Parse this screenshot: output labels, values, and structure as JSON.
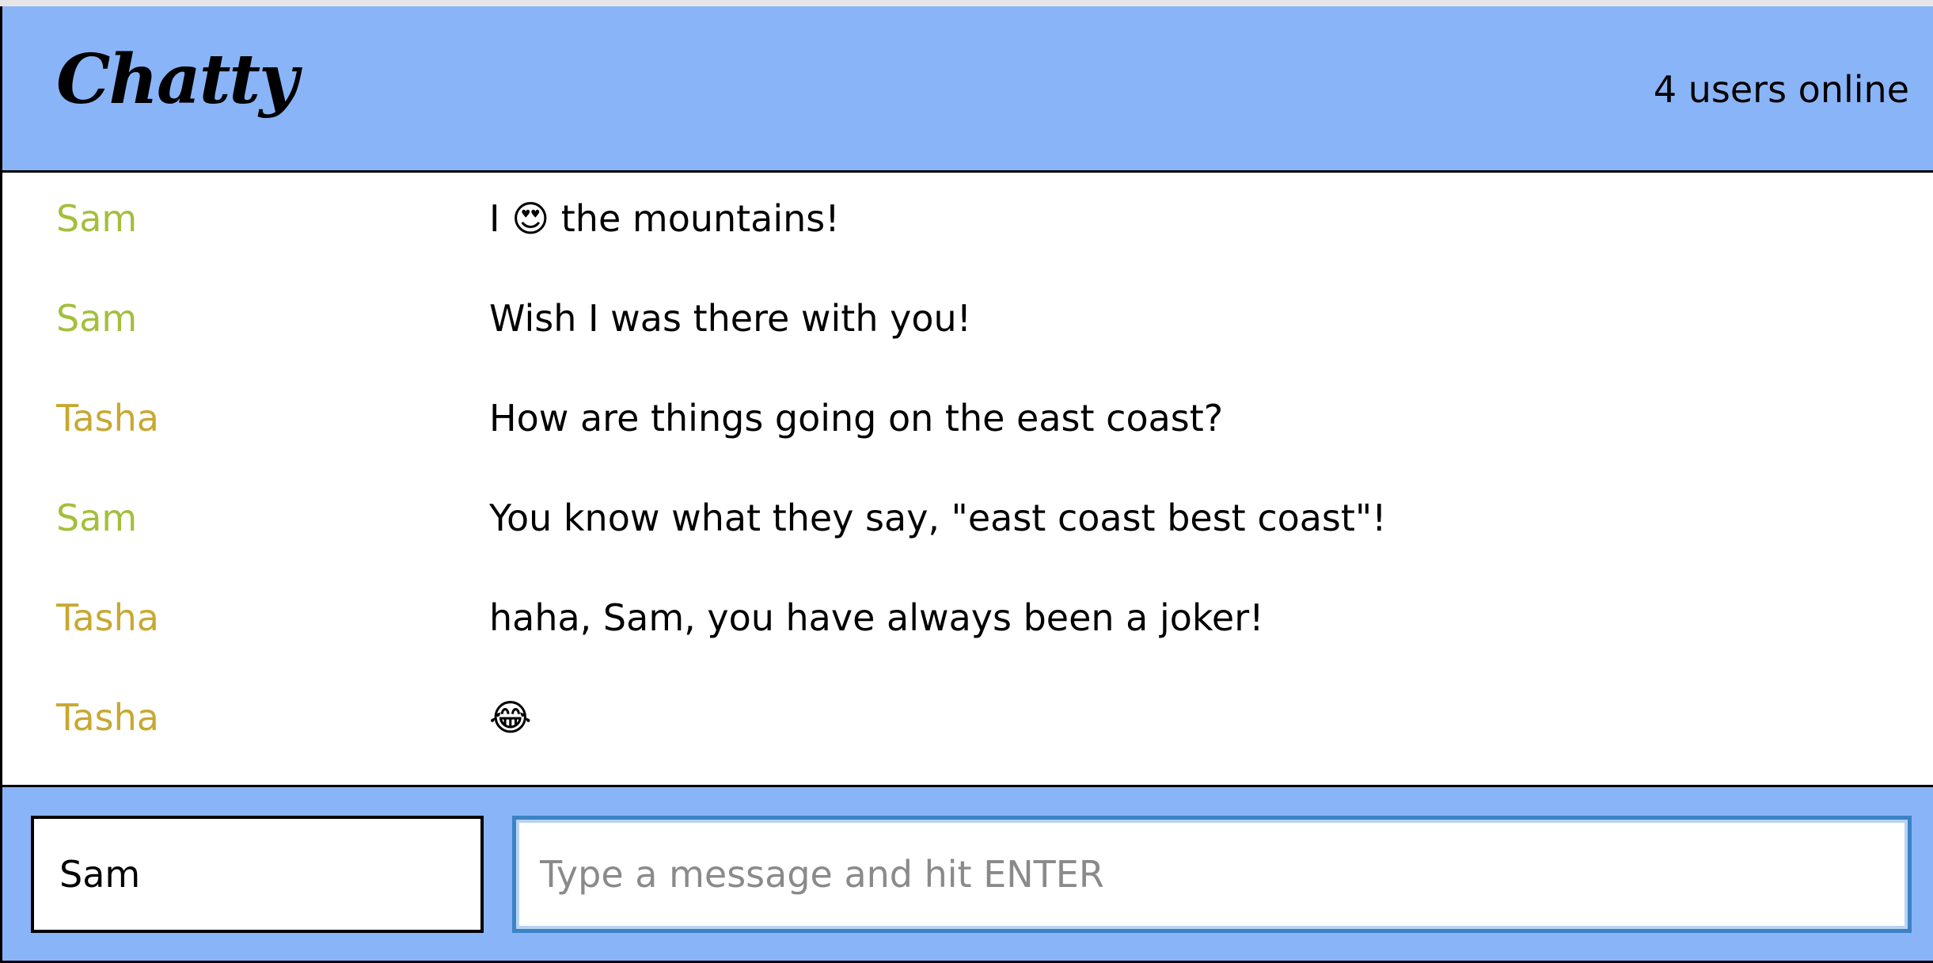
{
  "navbar": {
    "brand": "Chatty",
    "user_count": "4 users online"
  },
  "messages": [
    {
      "username": "Sam",
      "content": "I 😍 the mountains!",
      "color": "#a3bf3c"
    },
    {
      "username": "Sam",
      "content": "Wish I was there with you!",
      "color": "#a3bf3c"
    },
    {
      "username": "Tasha",
      "content": "How are things going on the east coast?",
      "color": "#c8a832"
    },
    {
      "username": "Sam",
      "content": "You know what they say, \"east coast best coast\"!",
      "color": "#a3bf3c"
    },
    {
      "username": "Tasha",
      "content": "haha, Sam, you have always been a joker!",
      "color": "#c8a832"
    },
    {
      "username": "Tasha",
      "content": "😂",
      "color": "#c8a832"
    }
  ],
  "chatbar": {
    "username_value": "Sam",
    "message_placeholder": "Type a message and hit ENTER"
  },
  "colors": {
    "bar_background": "#8ab4f8",
    "sam": "#a3bf3c",
    "tasha": "#c8a832"
  }
}
